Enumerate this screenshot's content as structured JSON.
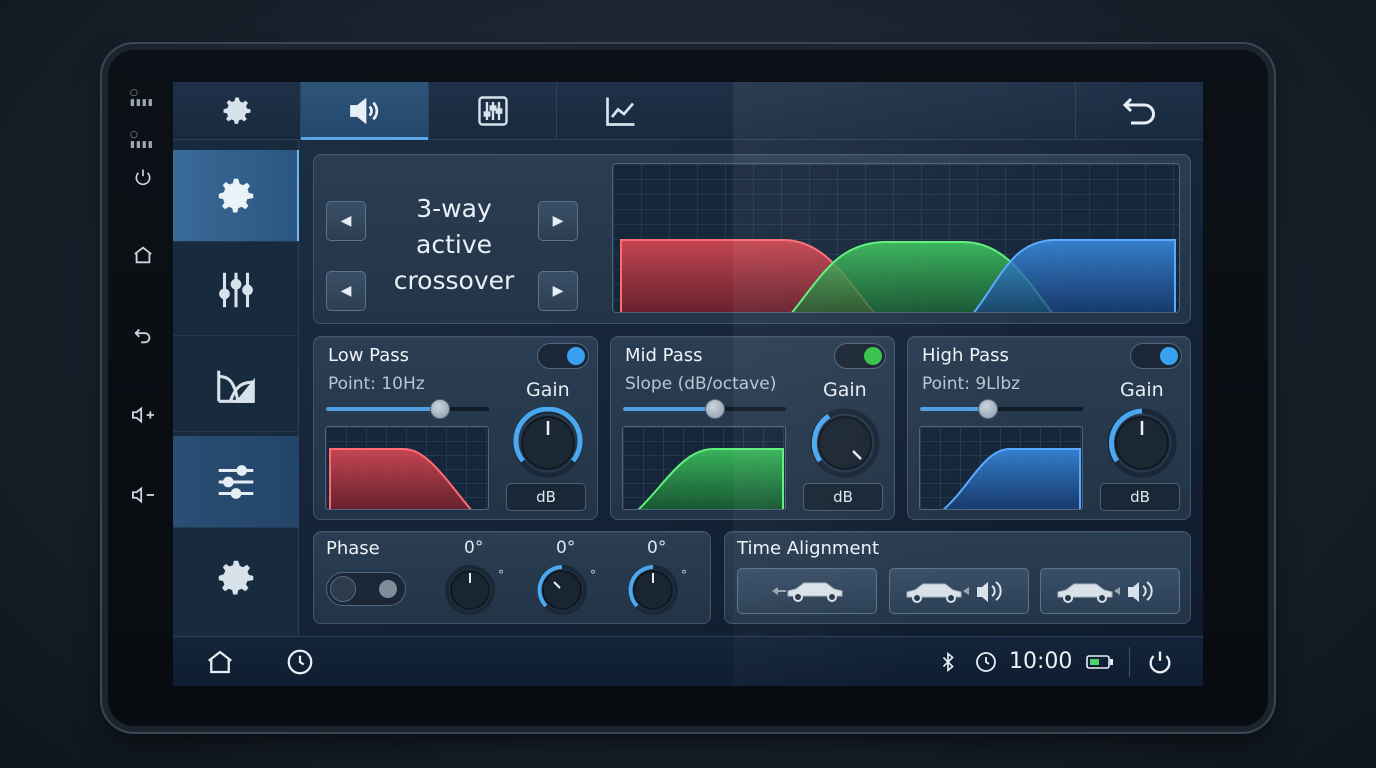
{
  "hardware_buttons": [
    {
      "name": "power",
      "glyph": "⏻"
    },
    {
      "name": "home",
      "glyph": "⌂"
    },
    {
      "name": "back",
      "glyph": "↶"
    },
    {
      "name": "volume-up",
      "glyph": "◁+"
    },
    {
      "name": "volume-down",
      "glyph": "◁−"
    }
  ],
  "top_tabs": [
    {
      "name": "settings",
      "icon": "gear-icon"
    },
    {
      "name": "sound",
      "icon": "speaker-icon",
      "active": true
    },
    {
      "name": "equalizer",
      "icon": "equalizer-icon"
    },
    {
      "name": "graph",
      "icon": "line-chart-icon"
    }
  ],
  "side_nav": [
    {
      "name": "settings",
      "icon": "gear-icon",
      "active": true
    },
    {
      "name": "mixer",
      "icon": "vertical-sliders-icon"
    },
    {
      "name": "crossover",
      "icon": "crossover-icon"
    },
    {
      "name": "adjust",
      "icon": "horizontal-sliders-icon",
      "highlight": true
    },
    {
      "name": "system",
      "icon": "gear-icon"
    }
  ],
  "crossover": {
    "title_line1": "3-way",
    "title_line2": "active",
    "title_line3": "crossover",
    "band_colors": {
      "low": "#c8404a",
      "mid": "#3fbf5a",
      "high": "#2f7fd8"
    }
  },
  "bands": [
    {
      "title": "Low Pass",
      "sub": "Point: 10Hz",
      "gain_label": "Gain",
      "unit": "dB",
      "toggle_color": "#3aa0f0",
      "slider_fraction": 0.7,
      "color": "#c8404a"
    },
    {
      "title": "Mid Pass",
      "sub": "Slope (dB/octave)",
      "gain_label": "Gain",
      "unit": "dB",
      "toggle_color": "#36c24a",
      "slider_fraction": 0.56,
      "color": "#36c24a"
    },
    {
      "title": "High Pass",
      "sub": "Point: 9Llbz",
      "gain_label": "Gain",
      "unit": "dB",
      "toggle_color": "#3aa0f0",
      "slider_fraction": 0.41,
      "color": "#2f7fd8"
    }
  ],
  "phase": {
    "label": "Phase",
    "channels": [
      {
        "value": "0°",
        "unit": "°"
      },
      {
        "value": "0°",
        "unit": "°"
      },
      {
        "value": "0°",
        "unit": "°"
      }
    ]
  },
  "time_alignment": {
    "label": "Time Alignment",
    "buttons": [
      {
        "name": "car-left"
      },
      {
        "name": "car-speaker-right"
      },
      {
        "name": "car-speaker-right-2"
      }
    ]
  },
  "status": {
    "time": "10:00",
    "bluetooth": true
  }
}
